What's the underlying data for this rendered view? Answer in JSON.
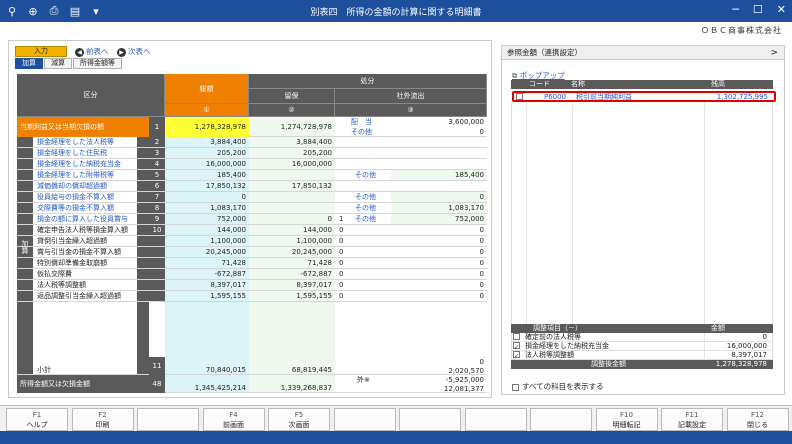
{
  "titlebar": {
    "title": "別表四　所得の金額の計算に関する明細書",
    "icons": [
      "search-plus-icon",
      "zoom-icon",
      "print-icon",
      "layout-icon",
      "dropdown-icon"
    ]
  },
  "company": "ＯＢＣ商事株式会社",
  "nav": {
    "input_tab": "入力",
    "prev": "前表へ",
    "next": "次表へ",
    "subtabs": [
      "加算",
      "減算",
      "所得金額等"
    ]
  },
  "grid": {
    "hdr_kubun": "区分",
    "hdr_sogaku": "総額",
    "hdr_shobun": "処分",
    "hdr_ryuho": "留保",
    "hdr_shagai": "社外流出",
    "hdr_c1": "①",
    "hdr_c2": "②",
    "hdr_c3": "③",
    "side_label": "加算",
    "rows": [
      {
        "label": "当期利益又は当期欠損の額",
        "no": "1",
        "c1": "1,278,328,978",
        "c2": "1,274,728,978",
        "t1": "配　当",
        "c3a": "3,600,000",
        "t2": "その他",
        "c3b": "0"
      },
      {
        "label": "損金経理をした法人税等",
        "no": "2",
        "c1": "3,884,400",
        "c2": "3,884,400",
        "t": "",
        "c3": ""
      },
      {
        "label": "損金経理をした住民税",
        "no": "3",
        "c1": "205,200",
        "c2": "205,200",
        "t": "",
        "c3": ""
      },
      {
        "label": "損金経理をした納税充当金",
        "no": "4",
        "c1": "16,000,000",
        "c2": "16,000,000",
        "t": "",
        "c3": ""
      },
      {
        "label": "損金経理をした附帯税等",
        "no": "5",
        "c1": "185,400",
        "c2": "",
        "t": "その他",
        "c3": "185,400"
      },
      {
        "label": "減価償却の償却超過額",
        "no": "6",
        "c1": "17,850,132",
        "c2": "17,850,132",
        "t": "",
        "c3": ""
      },
      {
        "label": "役員給与の損金不算入額",
        "no": "7",
        "c1": "0",
        "c2": "",
        "t": "その他",
        "c3": "0"
      },
      {
        "label": "交際費等の損金不算入額",
        "no": "8",
        "c1": "1,083,170",
        "c2": "",
        "t": "その他",
        "c3": "1,083,170"
      },
      {
        "label": "損金の額に算入した役員賞与",
        "no": "9",
        "c1": "752,000",
        "c2": "0",
        "n": "1",
        "t": "その他",
        "c3": "752,000"
      },
      {
        "label": "確定申告法人税等損金算入額",
        "no": "10",
        "c1": "144,000",
        "c2": "144,000",
        "n": "0",
        "t": "",
        "c3": "0"
      },
      {
        "label": "貸倒引当金繰入超過額",
        "no": "",
        "c1": "1,100,000",
        "c2": "1,100,000",
        "n": "0",
        "t": "",
        "c3": "0"
      },
      {
        "label": "賞与引当金の損金不算入額",
        "no": "",
        "c1": "20,245,000",
        "c2": "20,245,000",
        "n": "0",
        "t": "",
        "c3": "0"
      },
      {
        "label": "特別償却準備金取崩額",
        "no": "",
        "c1": "71,428",
        "c2": "71,428",
        "n": "0",
        "t": "",
        "c3": "0"
      },
      {
        "label": "仮払交際費",
        "no": "",
        "c1": "-672,887",
        "c2": "-672,887",
        "n": "0",
        "t": "",
        "c3": "0"
      },
      {
        "label": "法人税等調整額",
        "no": "",
        "c1": "8,397,017",
        "c2": "8,397,017",
        "n": "0",
        "t": "",
        "c3": "0"
      },
      {
        "label": "返品調整引当金繰入超過額",
        "no": "",
        "c1": "1,595,155",
        "c2": "1,595,155",
        "n": "0",
        "t": "",
        "c3": "0"
      }
    ],
    "subtotal": {
      "label": "小計",
      "no": "11",
      "c1": "70,840,015",
      "c2": "68,819,445",
      "c3a": "0",
      "c3b": "2,020,570"
    },
    "income": {
      "label": "所得金額又は欠損金額",
      "no": "48",
      "c1": "1,345,425,214",
      "c2": "1,339,268,837",
      "t": "外※",
      "c3a": "-5,925,000",
      "c3b": "12,081,377"
    }
  },
  "right": {
    "head": "参照金額（連携設定）",
    "popup": "ポップアップ",
    "cols": [
      "コード",
      "名称",
      "残高"
    ],
    "selected": {
      "code": "P6000",
      "name": "税引前当期純利益",
      "amount": "1,302,725,995"
    },
    "adj_header": [
      "調整項目（－）",
      "金額"
    ],
    "adj_rows": [
      {
        "checked": false,
        "label": "確定前の法人税等",
        "amount": "0"
      },
      {
        "checked": true,
        "label": "損金経理をした納税充当金",
        "amount": "16,000,000"
      },
      {
        "checked": true,
        "label": "法人税等調整額",
        "amount": "8,397,017"
      }
    ],
    "adj_total_label": "調整後金額",
    "adj_total": "1,278,328,978",
    "show_all": "すべての科目を表示する"
  },
  "fkeys": [
    {
      "key": "F1",
      "label": "ヘルプ"
    },
    {
      "key": "F2",
      "label": "印刷"
    },
    {
      "key": "",
      "label": ""
    },
    {
      "key": "F4",
      "label": "前画面"
    },
    {
      "key": "F5",
      "label": "次画面"
    },
    {
      "key": "",
      "label": ""
    },
    {
      "key": "",
      "label": ""
    },
    {
      "key": "",
      "label": ""
    },
    {
      "key": "",
      "label": ""
    },
    {
      "key": "F10",
      "label": "明細転記"
    },
    {
      "key": "F11",
      "label": "記載設定"
    },
    {
      "key": "F12",
      "label": "閉じる"
    }
  ]
}
